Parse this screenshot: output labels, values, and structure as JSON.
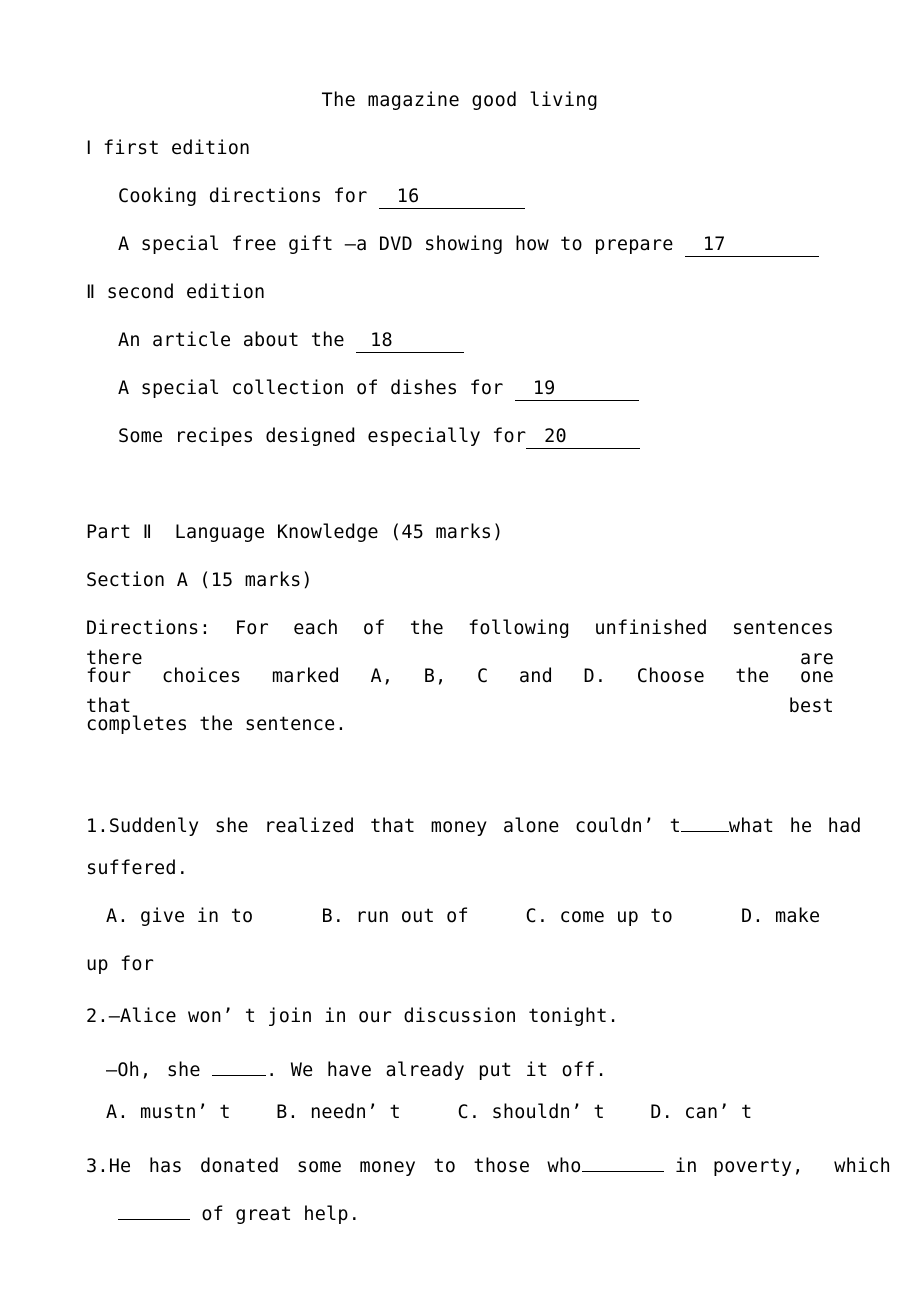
{
  "document": {
    "type": "exam-paper",
    "language": "English",
    "page_background": "#ffffff",
    "text_color": "#000000"
  },
  "title": "The magazine good living",
  "note_taking": {
    "sections": [
      {
        "heading": "Ⅰ first edition",
        "items": [
          {
            "text_before": "Cooking directions for ",
            "blank_label": "16",
            "text_after": ""
          },
          {
            "text_before": "A special free gift —a DVD showing how to prepare ",
            "blank_label": "17",
            "text_after": ""
          }
        ]
      },
      {
        "heading": "Ⅱ second edition",
        "items": [
          {
            "text_before": "An article about the ",
            "blank_label": "18",
            "text_after": ""
          },
          {
            "text_before": "A special collection of dishes for ",
            "blank_label": "19",
            "text_after": ""
          },
          {
            "text_before": "Some recipes designed especially for",
            "blank_label": "20",
            "text_after": ""
          }
        ]
      }
    ]
  },
  "part": {
    "heading": "Part Ⅱ  Language Knowledge (45 marks)",
    "section_heading": "Section A (15 marks)",
    "directions_lines": [
      "Directions: For each of the following unfinished sentences there are",
      "four choices marked A, B, C and D. Choose the one that best",
      "completes the sentence."
    ]
  },
  "questions": [
    {
      "number": "1.",
      "stem_lines": [
        "Suddenly she realized that money alone couldn’ t ____ what he had",
        "suffered."
      ],
      "options_lines": [
        "A. give in to      B. run out of     C. come up to      D. make",
        "up for"
      ],
      "options": [
        {
          "letter": "A.",
          "text": "give in to"
        },
        {
          "letter": "B.",
          "text": "run out of"
        },
        {
          "letter": "C.",
          "text": "come up to"
        },
        {
          "letter": "D.",
          "text": "make up for"
        }
      ]
    },
    {
      "number": "2.",
      "stem_lines": [
        "—Alice won’ t join in our discussion tonight.",
        "—Oh, she ____. We have already put it off."
      ],
      "options_lines": [
        "A. mustn’ t    B. needn’ t     C. shouldn’ t    D. can’ t"
      ],
      "options": [
        {
          "letter": "A.",
          "text": "mustn’ t"
        },
        {
          "letter": "B.",
          "text": "needn’ t"
        },
        {
          "letter": "C.",
          "text": "shouldn’ t"
        },
        {
          "letter": "D.",
          "text": "can’ t"
        }
      ]
    },
    {
      "number": "3.",
      "stem_lines": [
        "He has donated some money to those who______ in poverty, which",
        "______ of great help."
      ],
      "options_lines": [],
      "options": []
    }
  ],
  "fragments": {
    "q1_l1_a": "Suddenly she realized that money alone couldn’ t",
    "q1_l1_b": "what he had",
    "q1_l2": "suffered.",
    "q1_optA": "A. give in to",
    "q1_optB": "B. run out of",
    "q1_optC": "C. come up to",
    "q1_optD": "D. make",
    "q1_optD_cont": "up for",
    "q2_l1": "—Alice won’ t join in our discussion tonight.",
    "q2_l2_a": "—Oh, she",
    "q2_l2_b": ". We have already put it off.",
    "q2_optA": "A. mustn’ t",
    "q2_optB": "B. needn’ t",
    "q2_optC": "C. shouldn’ t",
    "q2_optD": "D. can’ t",
    "q3_l1_a": "He has donated some money to those who",
    "q3_l1_b": "in poverty,  which",
    "q3_l2_b": "of great help.",
    "num1": "1.",
    "num2": "2.",
    "num3": "3."
  }
}
